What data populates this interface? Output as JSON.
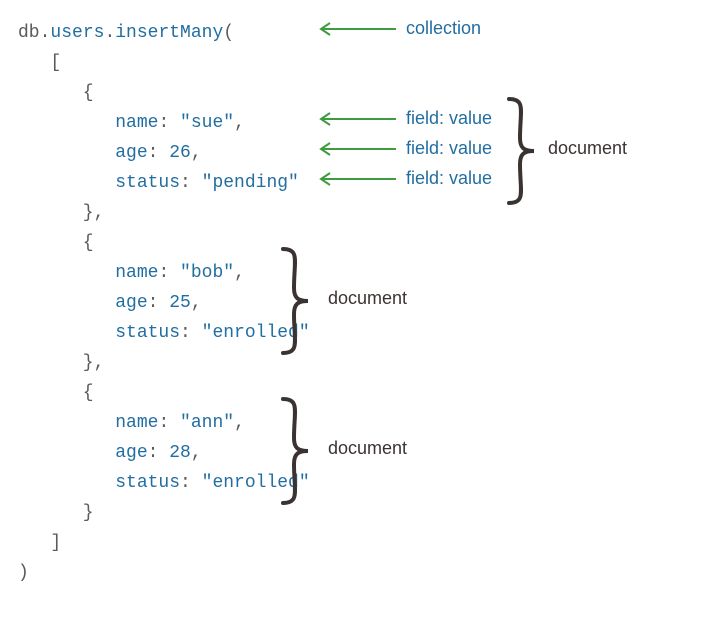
{
  "code": {
    "db": "db",
    "collection": "users",
    "method": "insertMany",
    "docs": [
      {
        "k0": "name",
        "v0": "\"sue\"",
        "k1": "age",
        "v1": "26",
        "k2": "status",
        "v2": "\"pending\""
      },
      {
        "k0": "name",
        "v0": "\"bob\"",
        "k1": "age",
        "v1": "25",
        "k2": "status",
        "v2": "\"enrolled\""
      },
      {
        "k0": "name",
        "v0": "\"ann\"",
        "k1": "age",
        "v1": "28",
        "k2": "status",
        "v2": "\"enrolled\""
      }
    ]
  },
  "ann": {
    "collection": "collection",
    "fieldvalue0": "field: value",
    "fieldvalue1": "field: value",
    "fieldvalue2": "field: value",
    "document0": "document",
    "document1": "document",
    "document2": "document"
  }
}
